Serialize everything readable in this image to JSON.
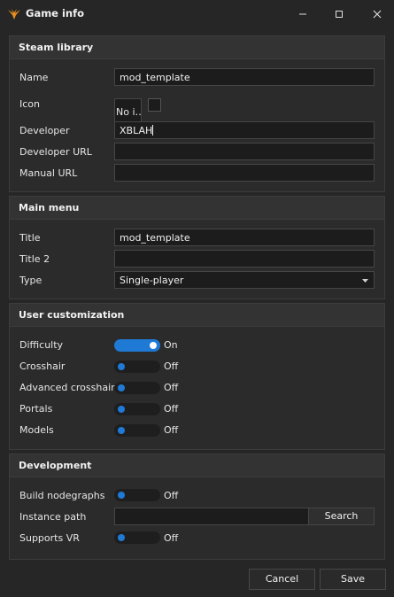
{
  "window": {
    "title": "Game info",
    "app_icon": "tree-logo-icon"
  },
  "steam_library": {
    "title": "Steam library",
    "name_label": "Name",
    "name_value": "mod_template",
    "icon_label": "Icon",
    "icon_value": "No i…",
    "developer_label": "Developer",
    "developer_value": "XBLAH",
    "developer_url_label": "Developer URL",
    "developer_url_value": "",
    "manual_url_label": "Manual URL",
    "manual_url_value": ""
  },
  "main_menu": {
    "title": "Main menu",
    "title_label": "Title",
    "title_value": "mod_template",
    "title2_label": "Title 2",
    "title2_value": "",
    "type_label": "Type",
    "type_value": "Single-player"
  },
  "user_customization": {
    "title": "User customization",
    "items": [
      {
        "label": "Difficulty",
        "state": "On",
        "on": true
      },
      {
        "label": "Crosshair",
        "state": "Off",
        "on": false
      },
      {
        "label": "Advanced crosshair",
        "state": "Off",
        "on": false
      },
      {
        "label": "Portals",
        "state": "Off",
        "on": false
      },
      {
        "label": "Models",
        "state": "Off",
        "on": false
      }
    ]
  },
  "development": {
    "title": "Development",
    "build_nodegraphs_label": "Build nodegraphs",
    "build_nodegraphs_state": "Off",
    "instance_path_label": "Instance path",
    "instance_path_value": "",
    "search_label": "Search",
    "supports_vr_label": "Supports VR",
    "supports_vr_state": "Off"
  },
  "footer": {
    "cancel_label": "Cancel",
    "save_label": "Save"
  },
  "colors": {
    "accent": "#1f7ad6",
    "background": "#262626",
    "panel": "#2b2b2b",
    "field": "#1c1c1c"
  }
}
